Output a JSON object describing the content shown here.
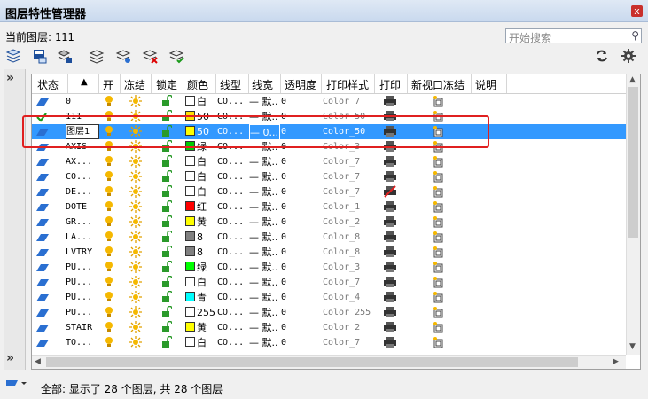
{
  "window": {
    "title": "图层特性管理器",
    "close_label": "x"
  },
  "current_layer": {
    "label": "当前图层:",
    "value": "111"
  },
  "search": {
    "placeholder": "开始搜索"
  },
  "sidebar": {
    "expand_top": "»",
    "expand_bottom": "»"
  },
  "columns": [
    "状态",
    "开",
    "冻结",
    "锁定",
    "颜色",
    "线型",
    "线宽",
    "透明度",
    "打印样式",
    "打印",
    "新视口冻结",
    "说明"
  ],
  "rows": [
    {
      "name": "0",
      "color_name": "白",
      "color": "#ffffff",
      "linetype": "CO...",
      "lineweight": "— 默...",
      "transparency": "0",
      "plot_style": "Color_7"
    },
    {
      "name": "111",
      "color_name": "50",
      "color": "#ffe000",
      "linetype": "CO...",
      "lineweight": "— 默...",
      "transparency": "0",
      "plot_style": "Color_50",
      "current": true
    },
    {
      "name": "图层1",
      "color_name": "50",
      "color": "#ffff00",
      "linetype": "CO...",
      "lineweight": "— 0...",
      "transparency": "0",
      "plot_style": "Color_50",
      "selected": true
    },
    {
      "name": "AXIS",
      "color_name": "绿",
      "color": "#00cc00",
      "linetype": "CO...",
      "lineweight": "— 默...",
      "transparency": "0",
      "plot_style": "Color_3"
    },
    {
      "name": "AX...",
      "color_name": "白",
      "color": "#ffffff",
      "linetype": "CO...",
      "lineweight": "— 默...",
      "transparency": "0",
      "plot_style": "Color_7"
    },
    {
      "name": "CO...",
      "color_name": "白",
      "color": "#ffffff",
      "linetype": "CO...",
      "lineweight": "— 默...",
      "transparency": "0",
      "plot_style": "Color_7"
    },
    {
      "name": "DE...",
      "color_name": "白",
      "color": "#ffffff",
      "linetype": "CO...",
      "lineweight": "— 默...",
      "transparency": "0",
      "plot_style": "Color_7",
      "noplot": true
    },
    {
      "name": "DOTE",
      "color_name": "红",
      "color": "#ff0000",
      "linetype": "CO...",
      "lineweight": "— 默...",
      "transparency": "0",
      "plot_style": "Color_1"
    },
    {
      "name": "GR...",
      "color_name": "黄",
      "color": "#ffff00",
      "linetype": "CO...",
      "lineweight": "— 默...",
      "transparency": "0",
      "plot_style": "Color_2"
    },
    {
      "name": "LA...",
      "color_name": "8",
      "color": "#808080",
      "linetype": "CO...",
      "lineweight": "— 默...",
      "transparency": "0",
      "plot_style": "Color_8"
    },
    {
      "name": "LVTRY",
      "color_name": "8",
      "color": "#808080",
      "linetype": "CO...",
      "lineweight": "— 默...",
      "transparency": "0",
      "plot_style": "Color_8"
    },
    {
      "name": "PU...",
      "color_name": "绿",
      "color": "#00ff00",
      "linetype": "CO...",
      "lineweight": "— 默...",
      "transparency": "0",
      "plot_style": "Color_3"
    },
    {
      "name": "PU...",
      "color_name": "白",
      "color": "#ffffff",
      "linetype": "CO...",
      "lineweight": "— 默...",
      "transparency": "0",
      "plot_style": "Color_7"
    },
    {
      "name": "PU...",
      "color_name": "青",
      "color": "#00ffff",
      "linetype": "CO...",
      "lineweight": "— 默...",
      "transparency": "0",
      "plot_style": "Color_4"
    },
    {
      "name": "PU...",
      "color_name": "255",
      "color": "#ffffff",
      "linetype": "CO...",
      "lineweight": "— 默...",
      "transparency": "0",
      "plot_style": "Color_255"
    },
    {
      "name": "STAIR",
      "color_name": "黄",
      "color": "#ffff00",
      "linetype": "CO...",
      "lineweight": "— 默...",
      "transparency": "0",
      "plot_style": "Color_2"
    },
    {
      "name": "TO...",
      "color_name": "白",
      "color": "#ffffff",
      "linetype": "CO...",
      "lineweight": "— 默...",
      "transparency": "0",
      "plot_style": "Color_7"
    }
  ],
  "status": {
    "text": "全部: 显示了 28 个图层, 共 28 个图层"
  }
}
